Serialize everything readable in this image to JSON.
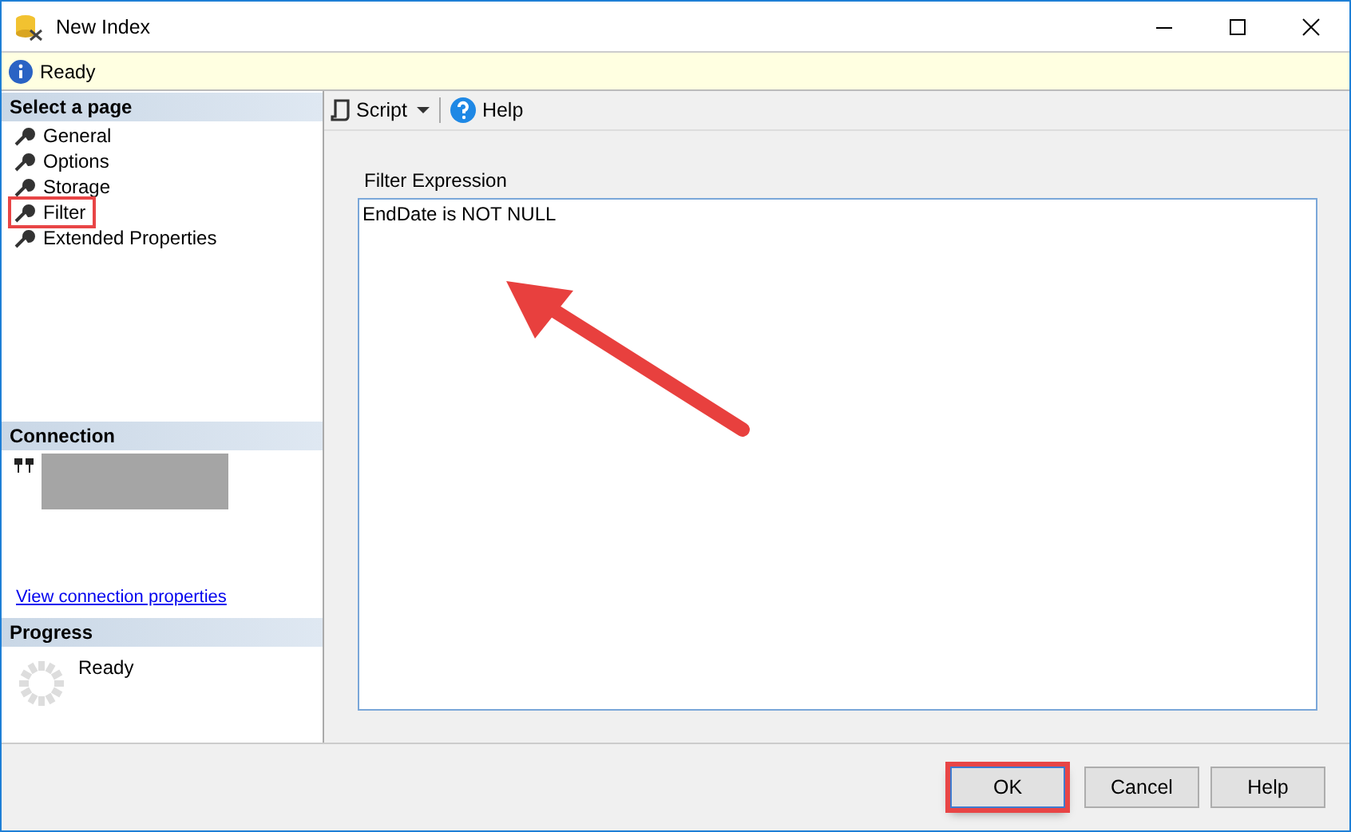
{
  "window": {
    "title": "New Index"
  },
  "status_bar": {
    "text": "Ready"
  },
  "sidebar": {
    "heading": "Select a page",
    "items": [
      {
        "label": "General",
        "selected": false
      },
      {
        "label": "Options",
        "selected": false
      },
      {
        "label": "Storage",
        "selected": false
      },
      {
        "label": "Filter",
        "selected": true
      },
      {
        "label": "Extended Properties",
        "selected": false
      }
    ]
  },
  "connection": {
    "heading": "Connection",
    "link": "View connection properties"
  },
  "progress": {
    "heading": "Progress",
    "status": "Ready"
  },
  "toolbar": {
    "script": "Script",
    "help": "Help"
  },
  "filter": {
    "label": "Filter Expression",
    "value": "EndDate is NOT NULL"
  },
  "buttons": [
    {
      "label": "OK",
      "highlighted": true
    },
    {
      "label": "Cancel",
      "highlighted": false
    },
    {
      "label": "Help",
      "highlighted": false
    }
  ]
}
